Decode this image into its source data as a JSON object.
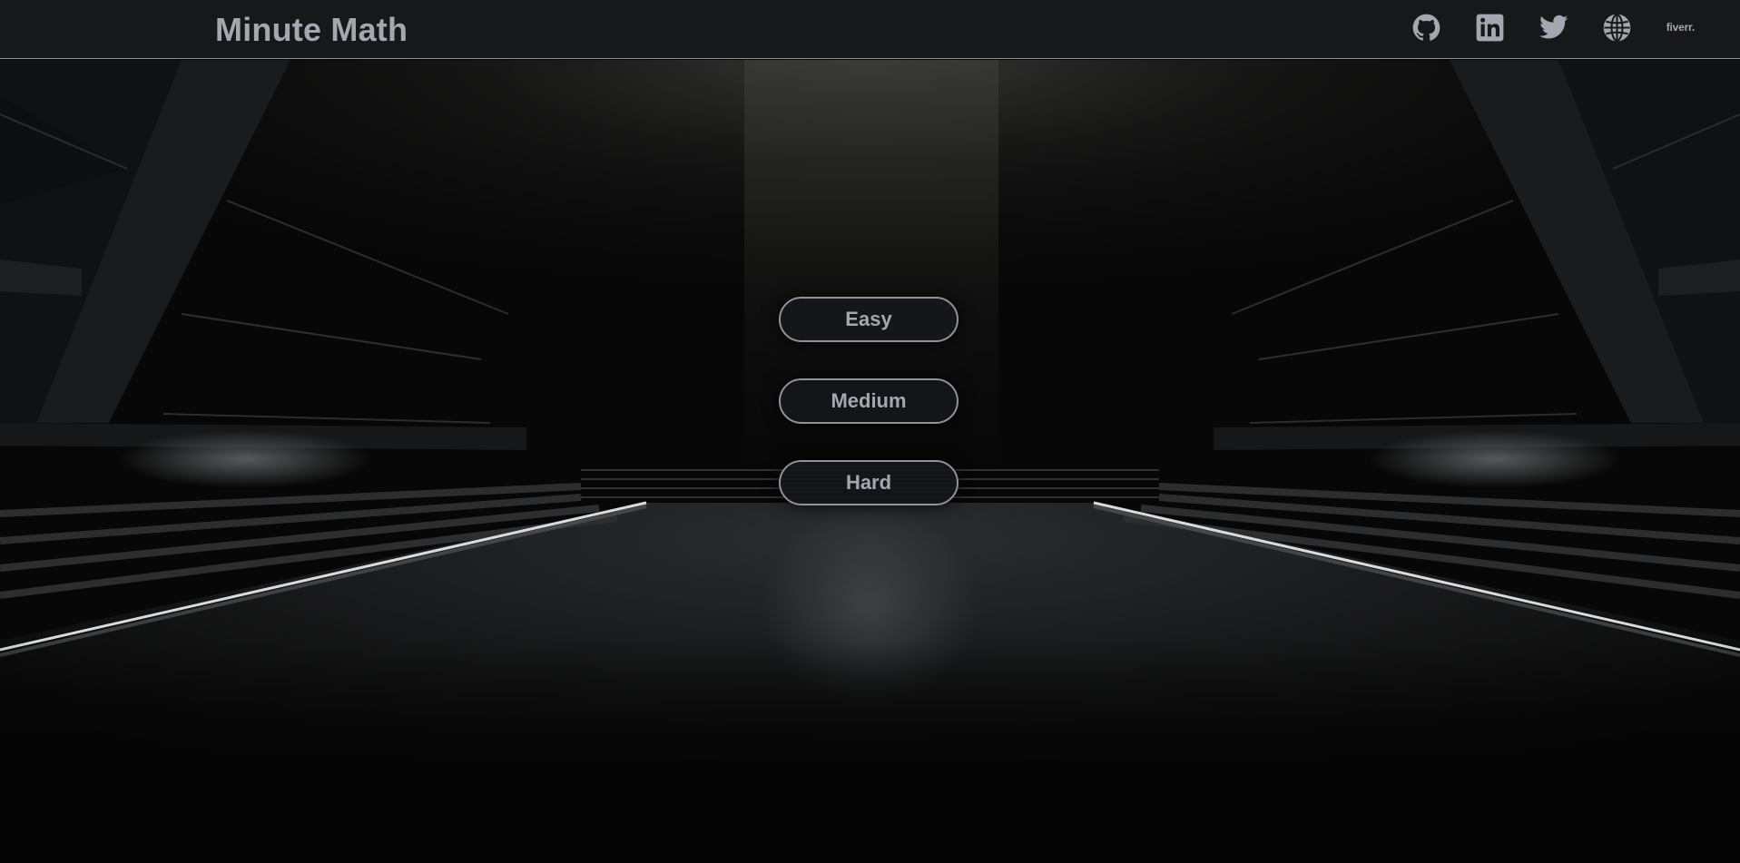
{
  "header": {
    "brand": "Minute Math",
    "links": [
      {
        "name": "github",
        "icon": "github-icon"
      },
      {
        "name": "linkedin",
        "icon": "linkedin-icon"
      },
      {
        "name": "twitter",
        "icon": "twitter-icon"
      },
      {
        "name": "website",
        "icon": "globe-icon"
      },
      {
        "name": "fiverr",
        "icon": "fiverr-icon",
        "label": "fiverr."
      }
    ]
  },
  "menu": {
    "easy_label": "Easy",
    "medium_label": "Medium",
    "hard_label": "Hard"
  },
  "colors": {
    "navbar_bg": "#17181a",
    "text": "#a3a8b0",
    "button_border": "#8f9298",
    "background": "#050505"
  }
}
